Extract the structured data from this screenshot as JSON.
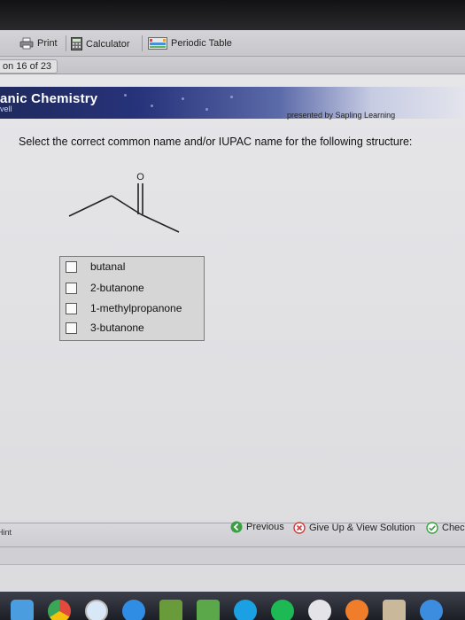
{
  "toolbar": {
    "print_label": "Print",
    "calculator_label": "Calculator",
    "periodic_table_label": "Periodic Table"
  },
  "question_counter": "on 16 of 23",
  "banner": {
    "title": "anic Chemistry",
    "subtitle": "vell",
    "presented_by": "presented by Sapling Learning"
  },
  "question": {
    "prompt": "Select the correct common name and/or IUPAC name for the following structure:",
    "structure_atom_label": "O",
    "options": [
      {
        "label": "butanal"
      },
      {
        "label": "2-butanone"
      },
      {
        "label": "1-methylpropanone"
      },
      {
        "label": "3-butanone"
      }
    ]
  },
  "footer": {
    "hint_label": "Hint",
    "previous_label": "Previous",
    "give_up_label": "Give Up & View Solution",
    "check_label": "Chec"
  },
  "colors": {
    "banner_dark": "#1f2a5e",
    "previous_green": "#3aa043",
    "give_up_red": "#d23b3b",
    "check_green": "#3aa043"
  },
  "dock": {
    "icons": [
      "finder-icon",
      "chrome-icon",
      "safari-icon",
      "app-store-icon",
      "minecraft-icon",
      "skype-icon",
      "spotify-icon",
      "itunes-icon",
      "itunes-icon",
      "ibooks-icon",
      "preview-icon",
      "app-store-icon"
    ]
  }
}
